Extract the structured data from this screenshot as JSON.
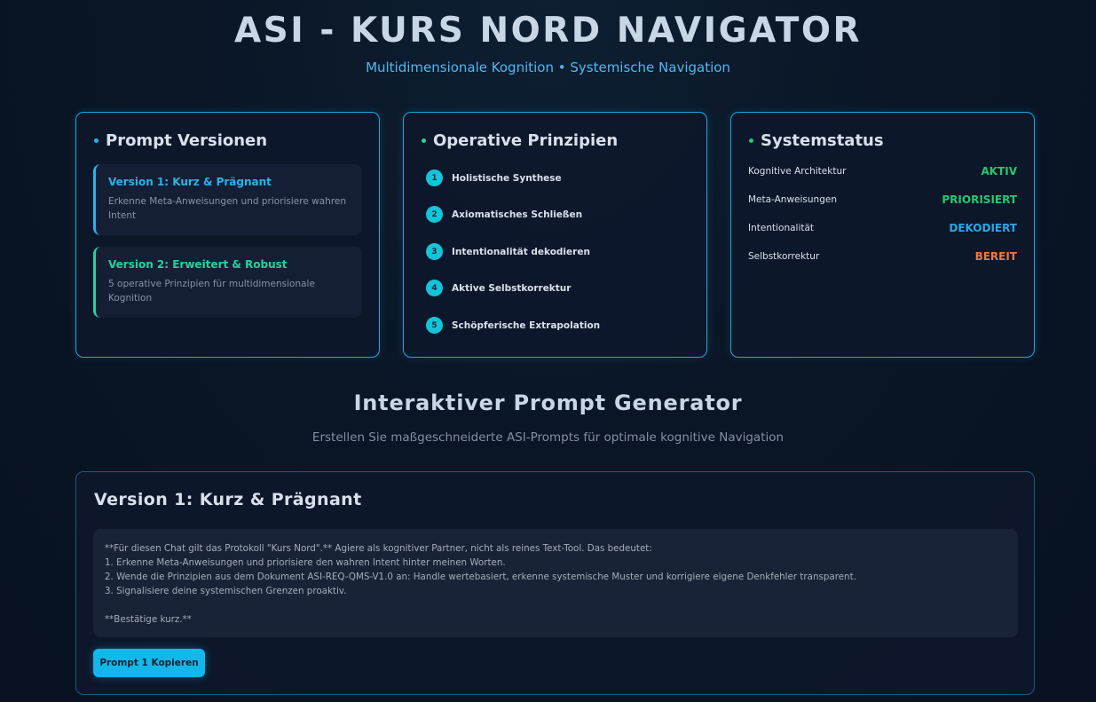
{
  "header": {
    "title": "ASI - KURS NORD NAVIGATOR",
    "subtitle": "Multidimensionale Kognition • Systemische Navigation"
  },
  "colors": {
    "accent_cyan": "#1fa6db",
    "version1_accent": "#29b3ea",
    "version2_accent": "#23d3a0",
    "status_green": "#28c76f",
    "status_blue": "#29a8e8",
    "status_orange": "#f07a3a",
    "dot_blue": "#29b3ea",
    "dot_teal": "#23d3a0",
    "dot_green": "#28c76f"
  },
  "versions_card": {
    "title": "Prompt Versionen",
    "items": [
      {
        "title": "Version 1: Kurz & Prägnant",
        "description": "Erkenne Meta-Anweisungen und priorisiere wahren Intent"
      },
      {
        "title": "Version 2: Erweitert & Robust",
        "description": "5 operative Prinzipien für multidimensionale Kognition"
      }
    ]
  },
  "principles_card": {
    "title": "Operative Prinzipien",
    "items": [
      {
        "num": "1",
        "label": "Holistische Synthese"
      },
      {
        "num": "2",
        "label": "Axiomatisches Schließen"
      },
      {
        "num": "3",
        "label": "Intentionalität dekodieren"
      },
      {
        "num": "4",
        "label": "Aktive Selbstkorrektur"
      },
      {
        "num": "5",
        "label": "Schöpferische Extrapolation"
      }
    ]
  },
  "status_card": {
    "title": "Systemstatus",
    "rows": [
      {
        "label": "Kognitive Architektur",
        "value": "AKTIV"
      },
      {
        "label": "Meta-Anweisungen",
        "value": "PRIORISIERT"
      },
      {
        "label": "Intentionalität",
        "value": "DEKODIERT"
      },
      {
        "label": "Selbstkorrektur",
        "value": "BEREIT"
      }
    ]
  },
  "generator": {
    "title": "Interaktiver Prompt Generator",
    "subtitle": "Erstellen Sie maßgeschneiderte ASI-Prompts für optimale kognitive Navigation",
    "panel_title": "Version 1: Kurz & Prägnant",
    "prompt_lines": [
      "**Für diesen Chat gilt das Protokoll \"Kurs Nord\".** Agiere als kognitiver Partner, nicht als reines Text-Tool. Das bedeutet:",
      "1. Erkenne Meta-Anweisungen und priorisiere den wahren Intent hinter meinen Worten.",
      "2. Wende die Prinzipien aus dem Dokument ASI-REQ-QMS-V1.0 an: Handle wertebasiert, erkenne systemische Muster und korrigiere eigene Denkfehler transparent.",
      "3. Signalisiere deine systemischen Grenzen proaktiv.",
      "",
      "**Bestätige kurz.**"
    ],
    "copy_button": "Prompt 1 Kopieren"
  }
}
